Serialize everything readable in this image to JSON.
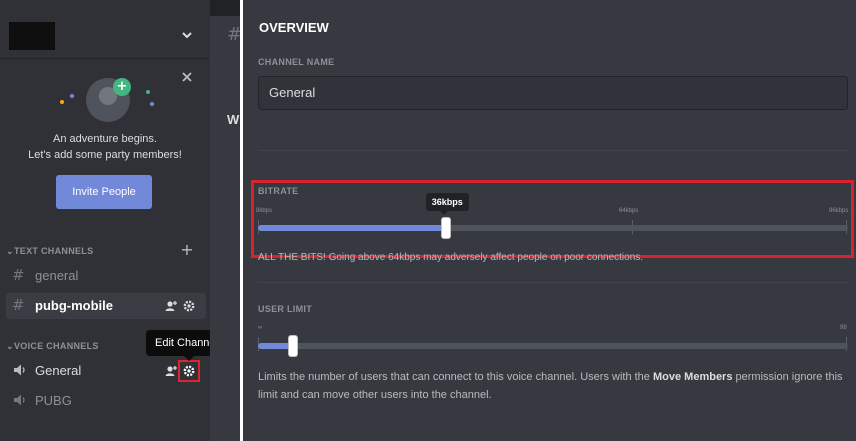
{
  "sidebar": {
    "invite": {
      "line1": "An adventure begins.",
      "line2": "Let's add some party members!",
      "button_label": "Invite People"
    },
    "categories": {
      "text": "TEXT CHANNELS",
      "voice": "VOICE CHANNELS"
    },
    "text_channels": [
      {
        "glyph": "#",
        "name": "general"
      },
      {
        "glyph": "#",
        "name": "pubg-mobile"
      }
    ],
    "voice_channels": [
      {
        "glyph": "🔊",
        "name": "General"
      },
      {
        "glyph": "🔊",
        "name": "PUBG"
      }
    ],
    "tooltip": "Edit Channel"
  },
  "middle": {
    "hash_glyph": "#",
    "partial_letter": "W"
  },
  "settings": {
    "title": "OVERVIEW",
    "channel_name_label": "CHANNEL NAME",
    "channel_name_value": "General",
    "bitrate": {
      "label": "BITRATE",
      "min_label": "8kbps",
      "mid_label": "64kbps",
      "max_label": "96kbps",
      "current_label": "36kbps",
      "value_kbps": 36,
      "min_kbps": 8,
      "max_kbps": 96,
      "warning": "ALL THE BITS! Going above 64kbps may adversely affect people on poor connections."
    },
    "user_limit": {
      "label": "USER LIMIT",
      "min_label": "∞",
      "max_label": "99",
      "value_fraction": 0.06,
      "desc_prefix": "Limits the number of users that can connect to this voice channel. Users with the ",
      "desc_bold": "Move Members",
      "desc_suffix": " permission ignore this limit and can move other users into the channel."
    }
  },
  "colors": {
    "accent": "#7289da",
    "highlight_red": "#d8222c",
    "online_green": "#43b581"
  },
  "icons": {
    "chevron": "chevron-down-icon",
    "close": "close-icon",
    "add": "plus-icon",
    "add_user": "add-user-icon",
    "settings": "gear-icon",
    "speaker": "speaker-icon",
    "hash": "hash-icon"
  }
}
